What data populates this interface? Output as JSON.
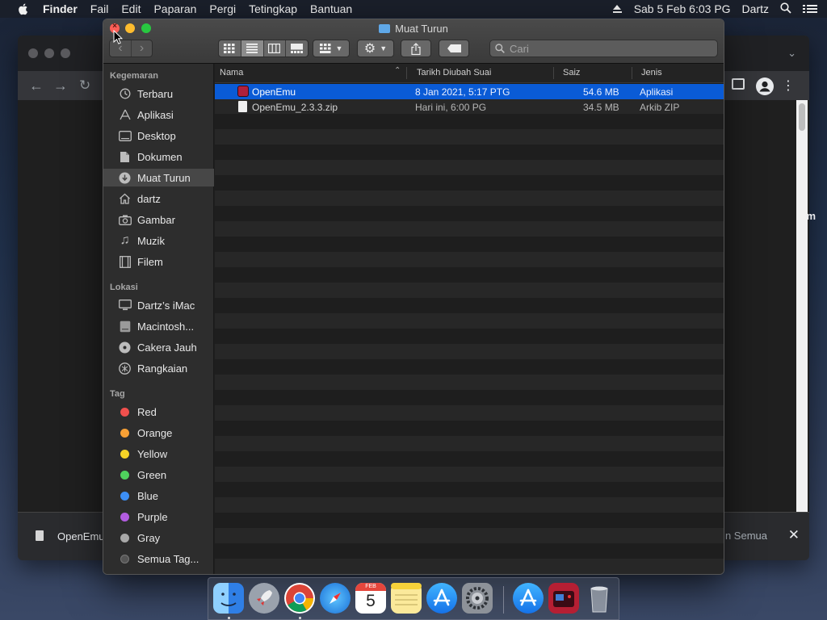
{
  "menubar": {
    "app": "Finder",
    "items": [
      "Fail",
      "Edit",
      "Paparan",
      "Pergi",
      "Tetingkap",
      "Bantuan"
    ],
    "datetime": "Sab 5 Feb  6:03 PG",
    "user": "Dartz"
  },
  "chrome": {
    "download_name": "OpenEmu",
    "show_all": "n Semua",
    "partial_text": "m"
  },
  "finder": {
    "title": "Muat Turun",
    "search_placeholder": "Cari",
    "sidebar": {
      "favorites_header": "Kegemaran",
      "favorites": [
        {
          "label": "Terbaru",
          "icon": "clock-icon"
        },
        {
          "label": "Aplikasi",
          "icon": "applications-icon"
        },
        {
          "label": "Desktop",
          "icon": "desktop-icon"
        },
        {
          "label": "Dokumen",
          "icon": "document-icon"
        },
        {
          "label": "Muat Turun",
          "icon": "download-icon"
        },
        {
          "label": "dartz",
          "icon": "home-icon"
        },
        {
          "label": "Gambar",
          "icon": "camera-icon"
        },
        {
          "label": "Muzik",
          "icon": "music-icon"
        },
        {
          "label": "Filem",
          "icon": "film-icon"
        }
      ],
      "locations_header": "Lokasi",
      "locations": [
        {
          "label": "Dartz’s iMac",
          "icon": "computer-icon"
        },
        {
          "label": "Macintosh...",
          "icon": "harddrive-icon"
        },
        {
          "label": "Cakera Jauh",
          "icon": "disc-icon"
        },
        {
          "label": "Rangkaian",
          "icon": "network-icon"
        }
      ],
      "tags_header": "Tag",
      "tags": [
        {
          "label": "Red",
          "color": "#f0504d"
        },
        {
          "label": "Orange",
          "color": "#f7a035"
        },
        {
          "label": "Yellow",
          "color": "#f5d327"
        },
        {
          "label": "Green",
          "color": "#4fd35d"
        },
        {
          "label": "Blue",
          "color": "#3d8ff5"
        },
        {
          "label": "Purple",
          "color": "#b25ce0"
        },
        {
          "label": "Gray",
          "color": "#a8a8a8"
        },
        {
          "label": "Semua Tag...",
          "color": "#555555"
        }
      ]
    },
    "columns": {
      "name": "Nama",
      "modified": "Tarikh Diubah Suai",
      "size": "Saiz",
      "kind": "Jenis"
    },
    "files": [
      {
        "name": "OpenEmu",
        "modified": "8 Jan 2021, 5:17 PTG",
        "size": "54.6 MB",
        "kind": "Aplikasi",
        "selected": true
      },
      {
        "name": "OpenEmu_2.3.3.zip",
        "modified": "Hari ini, 6:00 PG",
        "size": "34.5 MB",
        "kind": "Arkib ZIP",
        "selected": false
      }
    ]
  },
  "calendar": {
    "month": "FEB",
    "day": "5"
  },
  "colors": {
    "selection": "#0a5bd6",
    "accent_folder": "#5fa8e8"
  }
}
